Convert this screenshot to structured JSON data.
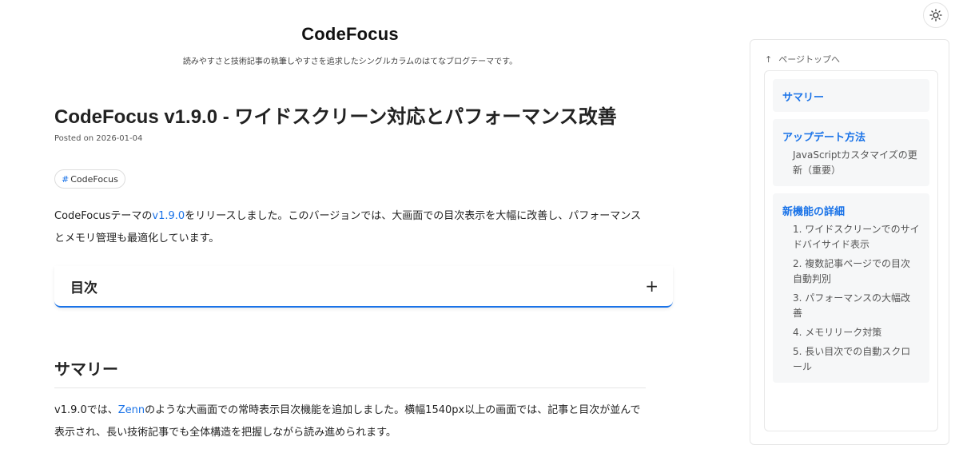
{
  "header": {
    "title": "CodeFocus",
    "description": "読みやすさと技術記事の執筆しやすさを追求したシングルカラムのはてなブログテーマです。"
  },
  "theme_toggle": {
    "icon": "sun-icon"
  },
  "post": {
    "title": "CodeFocus v1.9.0 - ワイドスクリーン対応とパフォーマンス改善",
    "date": "Posted on 2026-01-04",
    "tag_hash": "#",
    "tag": "CodeFocus",
    "intro_before": "CodeFocusテーマの",
    "intro_link": "v1.9.0",
    "intro_after": "をリリースしました。このバージョンでは、大画面での目次表示を大幅に改善し、パフォーマンスとメモリ管理も最適化しています。",
    "toc_title": "目次",
    "toc_toggle": "+",
    "section_title": "サマリー",
    "summary_before": "v1.9.0では、",
    "summary_link": "Zenn",
    "summary_after": "のような大画面での常時表示目次機能を追加しました。横幅1540px以上の画面では、記事と目次が並んで表示され、長い技術記事でも全体構造を把握しながら読み進められます。"
  },
  "sidebar": {
    "back_to_top_arrow": "↑",
    "back_to_top": "ページトップへ",
    "groups": [
      {
        "title": "サマリー",
        "items": []
      },
      {
        "title": "アップデート方法",
        "items": [
          "JavaScriptカスタマイズの更新（重要）"
        ]
      },
      {
        "title": "新機能の詳細",
        "items": [
          "1. ワイドスクリーンでのサイドバイサイド表示",
          "2. 複数記事ページでの目次自動判別",
          "3. パフォーマンスの大幅改善",
          "4. メモリリーク対策",
          "5. 長い目次での自動スクロール"
        ]
      }
    ]
  }
}
